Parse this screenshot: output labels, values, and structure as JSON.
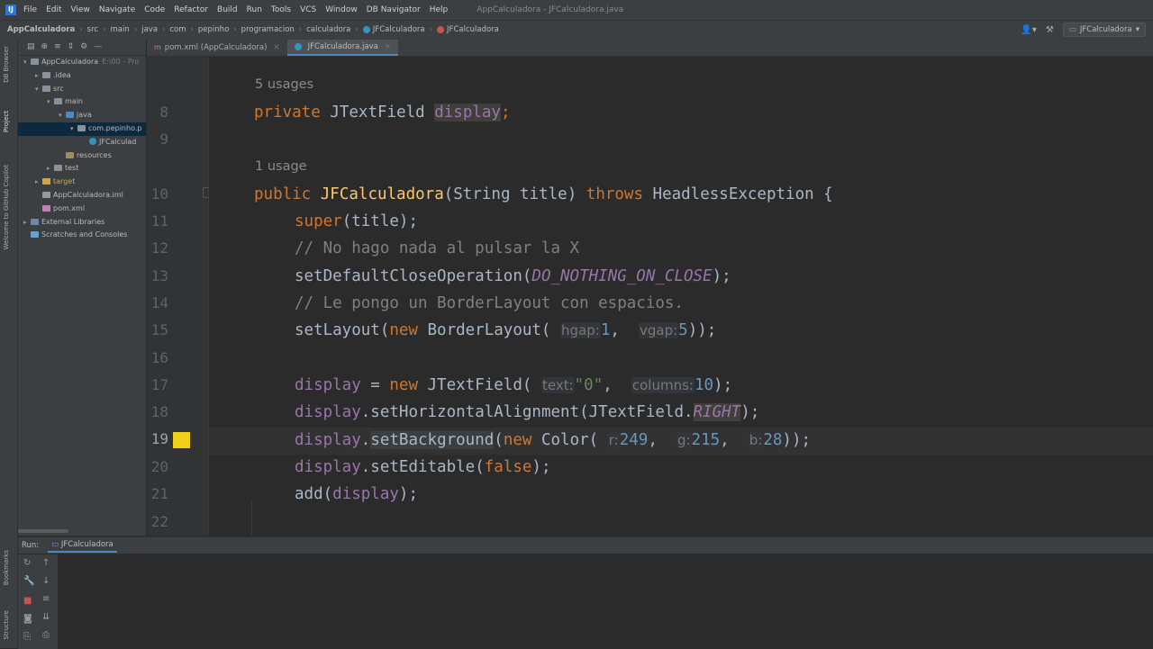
{
  "app_logo": "IJ",
  "menu": [
    "File",
    "Edit",
    "View",
    "Navigate",
    "Code",
    "Refactor",
    "Build",
    "Run",
    "Tools",
    "VCS",
    "Window",
    "DB Navigator",
    "Help"
  ],
  "window_title": "AppCalculadora - JFCalculadora.java",
  "breadcrumbs": [
    "AppCalculadora",
    "src",
    "main",
    "java",
    "com",
    "pepinho",
    "programacion",
    "calculadora",
    "JFCalculadora",
    "JFCalculadora"
  ],
  "run_config": "JFCalculadora",
  "left_strip": [
    "DB Browser",
    "Project",
    "Welcome to GitHub Copilot"
  ],
  "bottom_strip": [
    "Bookmarks",
    "Structure"
  ],
  "project_tree": [
    {
      "label": "AppCalculadora",
      "note": "E:\\00 - Pro",
      "indent": 0,
      "arrow": "▾",
      "icon": "folder"
    },
    {
      "label": ".idea",
      "indent": 1,
      "arrow": "▸",
      "icon": "folder"
    },
    {
      "label": "src",
      "indent": 1,
      "arrow": "▾",
      "icon": "folder"
    },
    {
      "label": "main",
      "indent": 2,
      "arrow": "▾",
      "icon": "folder"
    },
    {
      "label": "java",
      "indent": 3,
      "arrow": "▾",
      "icon": "src-folder"
    },
    {
      "label": "com.pepinho.p",
      "indent": 4,
      "arrow": "▾",
      "icon": "package",
      "selected": true
    },
    {
      "label": "JFCalculad",
      "indent": 5,
      "arrow": "",
      "icon": "class"
    },
    {
      "label": "resources",
      "indent": 3,
      "arrow": "",
      "icon": "res-folder"
    },
    {
      "label": "test",
      "indent": 2,
      "arrow": "▸",
      "icon": "folder"
    },
    {
      "label": "target",
      "indent": 1,
      "arrow": "▸",
      "icon": "target-folder"
    },
    {
      "label": "AppCalculadora.iml",
      "indent": 1,
      "arrow": "",
      "icon": "iml"
    },
    {
      "label": "pom.xml",
      "indent": 1,
      "arrow": "",
      "icon": "maven"
    },
    {
      "label": "External Libraries",
      "indent": 0,
      "arrow": "▸",
      "icon": "lib"
    },
    {
      "label": "Scratches and Consoles",
      "indent": 0,
      "arrow": "",
      "icon": "scratch"
    }
  ],
  "tabs": [
    {
      "label": "pom.xml (AppCalculadora)",
      "active": false
    },
    {
      "label": "JFCalculadora.java",
      "active": true
    }
  ],
  "editor": {
    "usage_5": "5 usages",
    "usage_1": "1 usage",
    "line_numbers": [
      "8",
      "9",
      "10",
      "11",
      "12",
      "13",
      "14",
      "15",
      "16",
      "17",
      "18",
      "19",
      "20",
      "21",
      "22"
    ],
    "current_line": "19",
    "t": {
      "private": "private",
      "JTextField": "JTextField",
      "display": "display",
      "semi": ";",
      "public": "public",
      "JFCalculadora": "JFCalculadora",
      "sig": "(String title) ",
      "throws": "throws",
      "headless": " HeadlessException {",
      "super": "super",
      "title_arg": "(title);",
      "cmt1": "// No hago nada al pulsar la X",
      "setDefaultClose": "setDefaultCloseOperation(",
      "DO_NOTHING": "DO_NOTHING_ON_CLOSE",
      "close_semi": ");",
      "cmt2": "// Le pongo un BorderLayout con espacios.",
      "setLayout": "setLayout(",
      "new": "new",
      "BorderLayout": " BorderLayout(",
      "hgap": "hgap:",
      "n1": "1",
      "comma": ", ",
      "vgap": "vgap:",
      "n5": "5",
      "close2": "));",
      "eq": " = ",
      "JTextFieldOpen": " JTextField(",
      "text": "text:",
      "s0": "\"0\"",
      "columns": "columns:",
      "n10": "10",
      "dotSetH": ".setHorizontalAlignment(JTextField.",
      "RIGHT": "RIGHT",
      "dot": ".",
      "setBackground": "setBackground",
      "open": "(",
      "Color": " Color(",
      "r": "r:",
      "n249": "249",
      "g": "g:",
      "n215": "215",
      "b": "b:",
      "n28": "28",
      "setEditable": ".setEditable(",
      "false": "false",
      "add": "add(",
      "close1": ");"
    }
  },
  "run_panel": {
    "label": "Run:",
    "tab": "JFCalculadora"
  },
  "colors": {
    "accent": "#4a88c7",
    "bulb": "#f1d21a",
    "keyword": "#cc7832",
    "field": "#9876aa",
    "method": "#ffc66d"
  }
}
